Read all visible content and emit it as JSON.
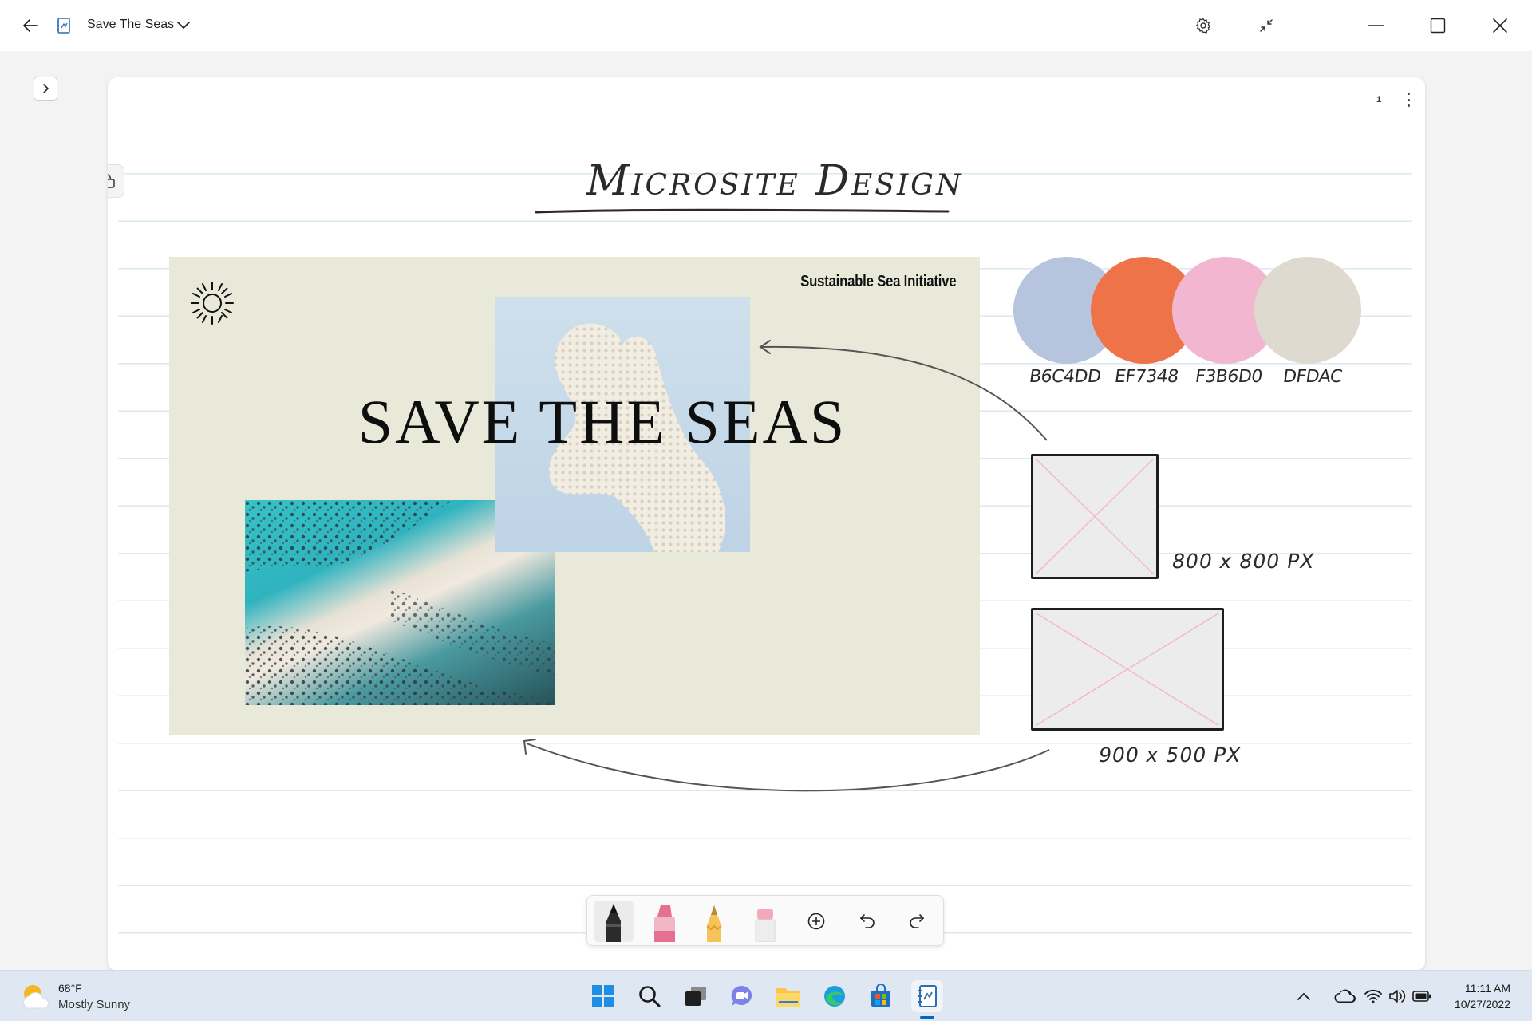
{
  "window": {
    "doc_title": "Save The Seas",
    "icons": {
      "back": "back-arrow-icon",
      "app": "journal-app-icon",
      "dropdown": "chevron-down-icon",
      "settings": "gear-icon",
      "collapse": "collapse-icon",
      "minimize": "minimize-icon",
      "maximize": "maximize-icon",
      "close": "close-icon"
    }
  },
  "page": {
    "page_number": "1",
    "handwritten_title": "Microsite Design"
  },
  "card": {
    "organization": "Sustainable Sea Initiative",
    "headline": "SAVE THE SEAS",
    "background": "#e9e9d9"
  },
  "swatches": [
    {
      "label": "B6C4DD",
      "color": "#B6C4DD"
    },
    {
      "label": "EF7348",
      "color": "#EF7348"
    },
    {
      "label": "F3B6D0",
      "color": "#F3B6D0"
    },
    {
      "label": "DFDAC",
      "color": "#DFDACF"
    }
  ],
  "wireframes": [
    {
      "label": "800 x 800 PX"
    },
    {
      "label": "900 x 500 PX"
    }
  ],
  "ink_tools": [
    {
      "name": "pen",
      "icon": "pen-icon",
      "active": true
    },
    {
      "name": "highlighter",
      "icon": "highlighter-icon",
      "active": false
    },
    {
      "name": "pencil",
      "icon": "pencil-icon",
      "active": false
    },
    {
      "name": "eraser",
      "icon": "eraser-icon",
      "active": false
    },
    {
      "name": "add",
      "icon": "plus-circle-icon",
      "active": false
    },
    {
      "name": "undo",
      "icon": "undo-icon",
      "active": false
    },
    {
      "name": "redo",
      "icon": "redo-icon",
      "active": false
    }
  ],
  "taskbar": {
    "weather_temp": "68°F",
    "weather_desc": "Mostly Sunny",
    "time": "11:11 AM",
    "date": "10/27/2022",
    "apps": [
      "start-icon",
      "search-icon",
      "task-view-icon",
      "chat-icon",
      "file-explorer-icon",
      "edge-icon",
      "store-icon",
      "journal-app-icon"
    ],
    "tray": [
      "chevron-up-icon",
      "onedrive-cloud-icon",
      "wifi-icon",
      "volume-icon",
      "battery-icon"
    ]
  }
}
